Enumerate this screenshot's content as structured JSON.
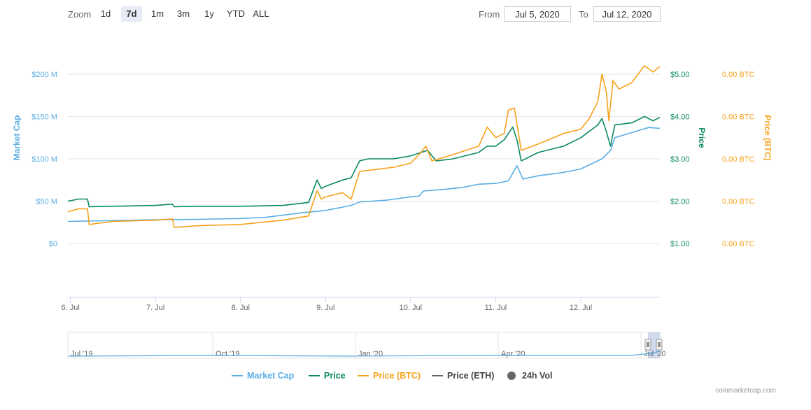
{
  "toolbar": {
    "zoom_label": "Zoom",
    "zoom_buttons": [
      "1d",
      "7d",
      "1m",
      "3m",
      "1y",
      "YTD",
      "ALL"
    ],
    "active_zoom": "7d",
    "from_label": "From",
    "from_value": "Jul 5, 2020",
    "to_label": "To",
    "to_value": "Jul 12, 2020"
  },
  "credit": "coinmarketcap.com",
  "chart_data": {
    "type": "line",
    "x_ticks": [
      "6. Jul",
      "7. Jul",
      "8. Jul",
      "9. Jul",
      "10. Jul",
      "11. Jul",
      "12. Jul"
    ],
    "y_left": {
      "label": "Market Cap",
      "ticks": [
        "$0",
        "$50 M",
        "$100 M",
        "$150 M",
        "$200 M"
      ],
      "range": [
        0,
        200
      ]
    },
    "y_price": {
      "label": "Price",
      "ticks": [
        "$1.00",
        "$2.00",
        "$3.00",
        "$4.00",
        "$5.00"
      ],
      "range": [
        1,
        5
      ]
    },
    "y_btc": {
      "label": "Price (BTC)",
      "ticks": [
        "0.00 BTC",
        "0.00 BTC",
        "0.00 BTC",
        "0.00 BTC",
        "0.00 BTC"
      ]
    },
    "x_range_days": [
      5.97,
      12.93
    ],
    "series": [
      {
        "name": "Market Cap",
        "color": "#5aaee3",
        "axis": "market_cap",
        "points": [
          [
            5.97,
            26
          ],
          [
            6.2,
            26.5
          ],
          [
            6.5,
            27
          ],
          [
            7.0,
            28
          ],
          [
            7.5,
            28.5
          ],
          [
            8.0,
            29.5
          ],
          [
            8.3,
            31
          ],
          [
            8.7,
            36
          ],
          [
            9.0,
            39
          ],
          [
            9.3,
            45
          ],
          [
            9.4,
            49
          ],
          [
            9.7,
            51
          ],
          [
            10.0,
            55
          ],
          [
            10.1,
            56
          ],
          [
            10.15,
            62
          ],
          [
            10.4,
            64
          ],
          [
            10.6,
            66
          ],
          [
            10.8,
            70
          ],
          [
            11.0,
            71
          ],
          [
            11.15,
            74
          ],
          [
            11.25,
            92
          ],
          [
            11.32,
            76
          ],
          [
            11.5,
            80
          ],
          [
            11.8,
            84
          ],
          [
            12.0,
            88
          ],
          [
            12.25,
            100
          ],
          [
            12.35,
            110
          ],
          [
            12.4,
            125
          ],
          [
            12.6,
            131
          ],
          [
            12.8,
            137
          ],
          [
            12.93,
            136
          ]
        ]
      },
      {
        "name": "Price",
        "color": "#0b8a63",
        "axis": "price",
        "points": [
          [
            5.97,
            2.0
          ],
          [
            6.1,
            2.05
          ],
          [
            6.2,
            2.05
          ],
          [
            6.22,
            1.87
          ],
          [
            6.5,
            1.88
          ],
          [
            7.0,
            1.9
          ],
          [
            7.2,
            1.93
          ],
          [
            7.22,
            1.87
          ],
          [
            7.5,
            1.88
          ],
          [
            8.0,
            1.88
          ],
          [
            8.5,
            1.9
          ],
          [
            8.8,
            1.97
          ],
          [
            8.9,
            2.5
          ],
          [
            8.95,
            2.3
          ],
          [
            9.0,
            2.35
          ],
          [
            9.2,
            2.5
          ],
          [
            9.3,
            2.55
          ],
          [
            9.4,
            2.95
          ],
          [
            9.5,
            3.0
          ],
          [
            9.8,
            3.0
          ],
          [
            10.0,
            3.07
          ],
          [
            10.2,
            3.2
          ],
          [
            10.3,
            2.95
          ],
          [
            10.5,
            3.0
          ],
          [
            10.8,
            3.15
          ],
          [
            10.9,
            3.3
          ],
          [
            11.0,
            3.3
          ],
          [
            11.1,
            3.45
          ],
          [
            11.2,
            3.75
          ],
          [
            11.25,
            3.45
          ],
          [
            11.3,
            2.95
          ],
          [
            11.5,
            3.15
          ],
          [
            11.8,
            3.3
          ],
          [
            12.0,
            3.5
          ],
          [
            12.2,
            3.8
          ],
          [
            12.25,
            3.95
          ],
          [
            12.3,
            3.65
          ],
          [
            12.35,
            3.3
          ],
          [
            12.4,
            3.8
          ],
          [
            12.6,
            3.85
          ],
          [
            12.75,
            4.0
          ],
          [
            12.85,
            3.9
          ],
          [
            12.93,
            3.98
          ]
        ]
      },
      {
        "name": "Price (BTC)",
        "color": "#f7a21b",
        "axis": "price",
        "points": [
          [
            5.97,
            1.75
          ],
          [
            6.1,
            1.82
          ],
          [
            6.2,
            1.82
          ],
          [
            6.22,
            1.45
          ],
          [
            6.5,
            1.52
          ],
          [
            7.0,
            1.55
          ],
          [
            7.2,
            1.58
          ],
          [
            7.22,
            1.38
          ],
          [
            7.5,
            1.42
          ],
          [
            8.0,
            1.45
          ],
          [
            8.5,
            1.55
          ],
          [
            8.8,
            1.65
          ],
          [
            8.9,
            2.25
          ],
          [
            8.95,
            2.05
          ],
          [
            9.0,
            2.1
          ],
          [
            9.2,
            2.2
          ],
          [
            9.3,
            2.05
          ],
          [
            9.4,
            2.7
          ],
          [
            9.6,
            2.75
          ],
          [
            9.8,
            2.8
          ],
          [
            10.0,
            2.9
          ],
          [
            10.1,
            3.1
          ],
          [
            10.18,
            3.3
          ],
          [
            10.25,
            2.95
          ],
          [
            10.5,
            3.1
          ],
          [
            10.8,
            3.3
          ],
          [
            10.9,
            3.75
          ],
          [
            11.0,
            3.5
          ],
          [
            11.1,
            3.6
          ],
          [
            11.15,
            4.15
          ],
          [
            11.22,
            4.2
          ],
          [
            11.3,
            3.2
          ],
          [
            11.5,
            3.35
          ],
          [
            11.8,
            3.6
          ],
          [
            12.0,
            3.7
          ],
          [
            12.1,
            3.95
          ],
          [
            12.2,
            4.35
          ],
          [
            12.25,
            5.0
          ],
          [
            12.3,
            4.6
          ],
          [
            12.33,
            3.9
          ],
          [
            12.38,
            4.85
          ],
          [
            12.45,
            4.65
          ],
          [
            12.6,
            4.8
          ],
          [
            12.75,
            5.2
          ],
          [
            12.85,
            5.05
          ],
          [
            12.93,
            5.18
          ]
        ]
      },
      {
        "name": "Price (ETH)",
        "color": "#666666",
        "axis": "price",
        "points": []
      },
      {
        "name": "24h Vol",
        "color": "#666666",
        "axis": "volume",
        "points": []
      }
    ],
    "navigator": {
      "labels": [
        "Jul '19",
        "Oct '19",
        "Jan '20",
        "Apr '20",
        "Jul '20"
      ]
    },
    "grid": true,
    "legend_position": "bottom"
  }
}
